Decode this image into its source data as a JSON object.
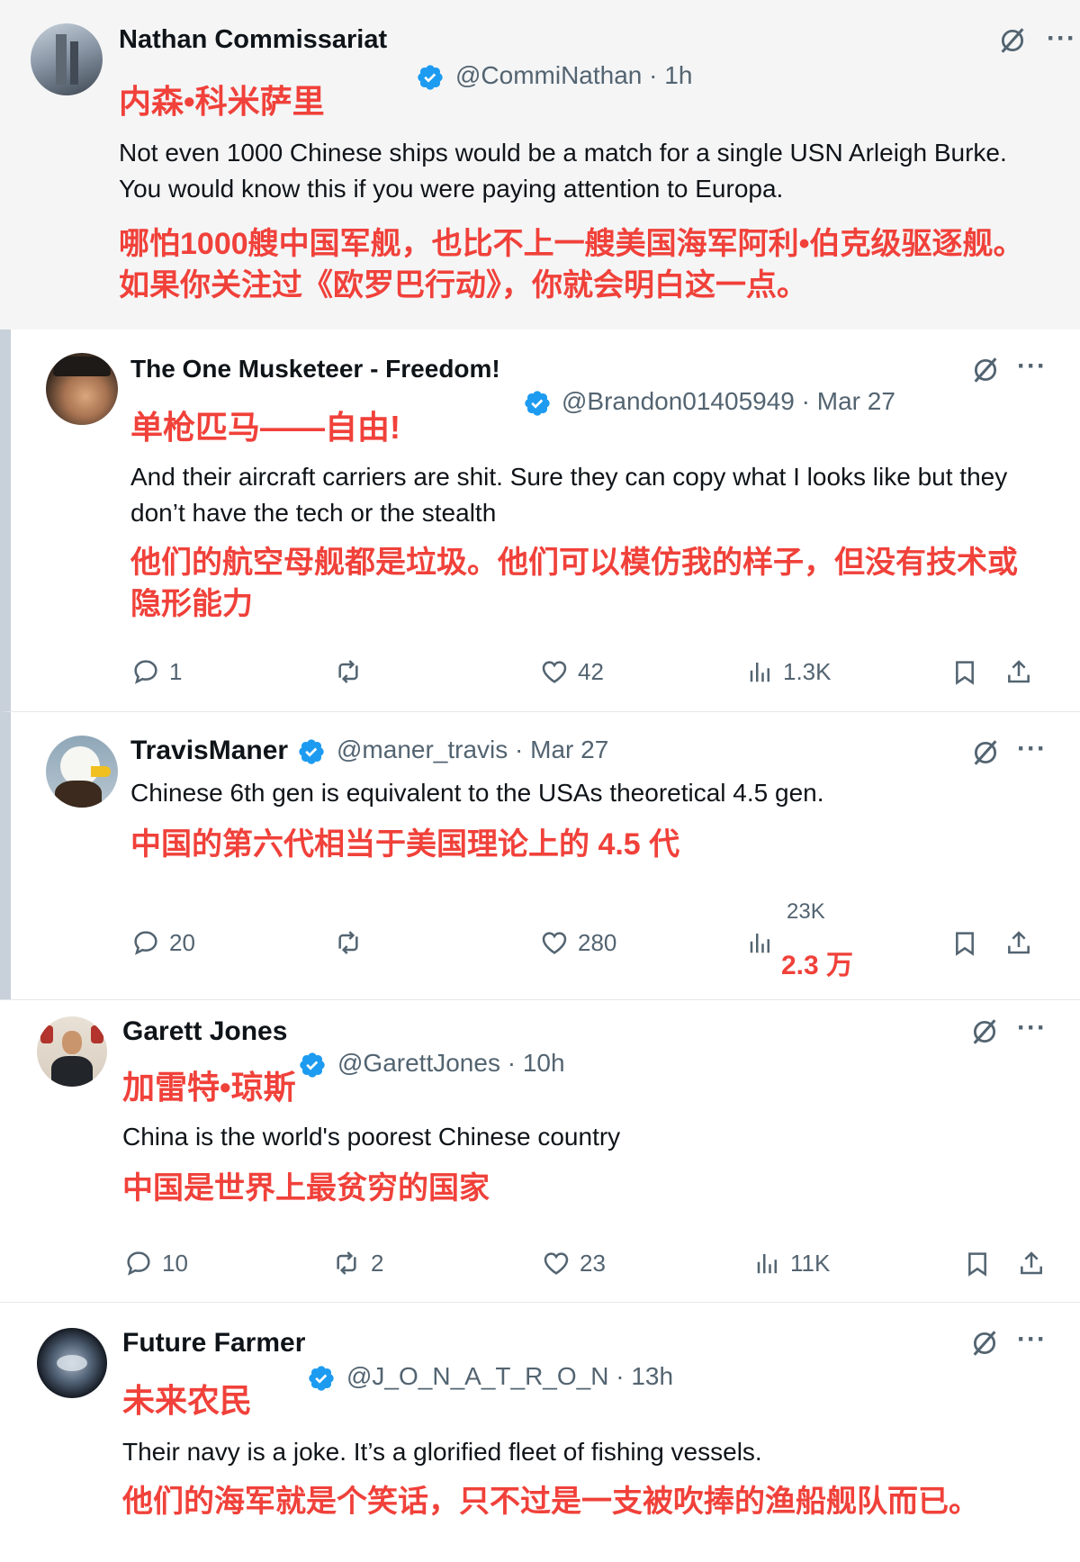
{
  "tweets": [
    {
      "name": "Nathan Commissariat",
      "name_cn": "内森•科米萨里",
      "handle_time": "@CommiNathan · 1h",
      "text": "Not even 1000 Chinese ships would be a match for a single USN Arleigh Burke. You would know this if you were paying attention to Europa.",
      "text_cn": "哪怕1000艘中国军舰，也比不上一艘美国海军阿利•伯克级驱逐舰。如果你关注过《欧罗巴行动》，你就会明白这一点。"
    },
    {
      "name": "The One Musketeer - Freedom!",
      "name_cn": "单枪匹马——自由!",
      "handle_time": "@Brandon01405949 · Mar 27",
      "text": "And their aircraft carriers are shit. Sure they can copy what I looks like but they don’t have the tech or the stealth",
      "text_cn": "他们的航空母舰都是垃圾。他们可以模仿我的样子，但没有技术或隐形能力",
      "replies": "1",
      "likes": "42",
      "views": "1.3K"
    },
    {
      "name": "TravisManer",
      "handle_time": "@maner_travis · Mar 27",
      "text": "Chinese 6th gen is equivalent to the USAs theoretical 4.5 gen.",
      "text_cn": "中国的第六代相当于美国理论上的 4.5 代",
      "replies": "20",
      "likes": "280",
      "views": "23K",
      "views_cn": "2.3 万"
    },
    {
      "name": "Garett Jones",
      "name_cn": "加雷特•琼斯",
      "handle_time": "@GarettJones · 10h",
      "text": "China is the world's poorest Chinese country",
      "text_cn": "中国是世界上最贫穷的国家",
      "replies": "10",
      "reposts": "2",
      "likes": "23",
      "views": "11K"
    },
    {
      "name": "Future Farmer",
      "name_cn": "未来农民",
      "handle_time": "@J_O_N_A_T_R_O_N · 13h",
      "text": "Their navy is a joke. It’s a glorified fleet of fishing vessels.",
      "text_cn": "他们的海军就是个笑话，只不过是一支被吹捧的渔船舰队而已。"
    }
  ],
  "more_label": "···",
  "icons": {
    "verified": "verified-badge-icon",
    "grok": "grok-icon",
    "reply": "reply-icon",
    "repost": "repost-icon",
    "like": "heart-icon",
    "views": "views-icon",
    "bookmark": "bookmark-icon",
    "share": "share-icon"
  },
  "colors": {
    "accent_red": "#f0413a",
    "verified_blue": "#1d9bf0",
    "muted": "#536471"
  }
}
